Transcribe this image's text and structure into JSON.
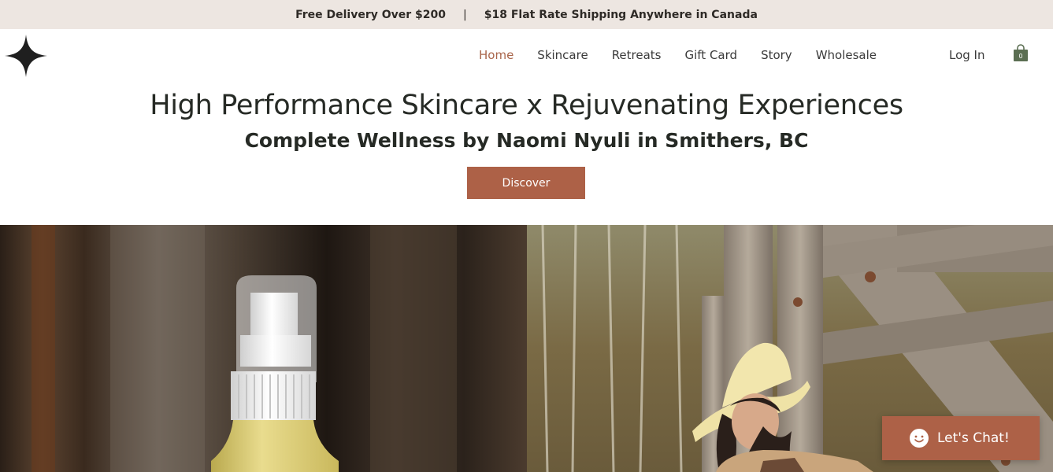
{
  "announcement": {
    "left": "Free Delivery Over $200",
    "separator": "|",
    "right": "$18 Flat Rate Shipping Anywhere in Canada"
  },
  "logo": {
    "icon": "four-point-star-icon"
  },
  "nav": {
    "items": [
      {
        "label": "Home",
        "active": true
      },
      {
        "label": "Skincare"
      },
      {
        "label": "Retreats"
      },
      {
        "label": "Gift Card"
      },
      {
        "label": "Story"
      },
      {
        "label": "Wholesale"
      }
    ]
  },
  "header": {
    "login_label": "Log In",
    "cart_icon": "shopping-bag-icon",
    "cart_count": "0"
  },
  "hero": {
    "title": "High Performance Skincare x Rejuvenating Experiences",
    "subtitle": "Complete Wellness by Naomi Nyuli in Smithers, BC",
    "cta_label": "Discover"
  },
  "chat": {
    "label": "Let's Chat!",
    "icon": "smiley-chat-icon"
  },
  "colors": {
    "accent": "#ad6147",
    "announcement_bg": "#ede6e1",
    "active_nav": "#a9654a",
    "cart_green": "#5b6e52"
  }
}
